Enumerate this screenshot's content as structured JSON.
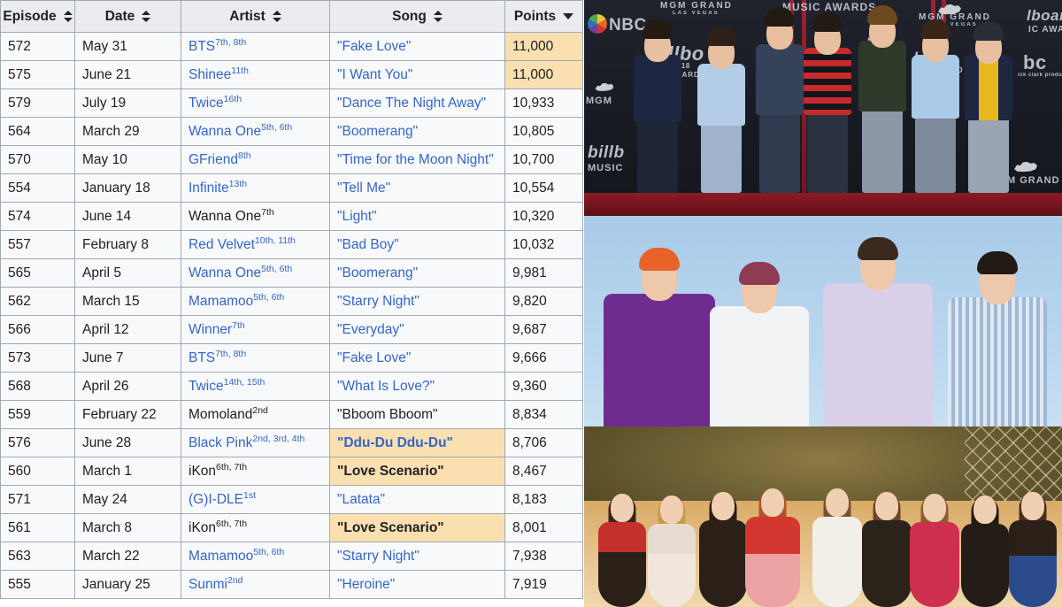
{
  "table": {
    "columns": [
      {
        "label": "Episode",
        "sort": "both"
      },
      {
        "label": "Date",
        "sort": "both"
      },
      {
        "label": "Artist",
        "sort": "both"
      },
      {
        "label": "Song",
        "sort": "both"
      },
      {
        "label": "Points",
        "sort": "desc"
      }
    ],
    "rows": [
      {
        "episode": "572",
        "date": "May 31",
        "artist": "BTS",
        "artist_refs": "7th, 8th",
        "artist_link": true,
        "song": "\"Fake Love\"",
        "song_link": true,
        "points": "11,000",
        "points_highlight": true,
        "song_highlight": false
      },
      {
        "episode": "575",
        "date": "June 21",
        "artist": "Shinee",
        "artist_refs": "11th",
        "artist_link": true,
        "song": "\"I Want You\"",
        "song_link": true,
        "points": "11,000",
        "points_highlight": true,
        "song_highlight": false
      },
      {
        "episode": "579",
        "date": "July 19",
        "artist": "Twice",
        "artist_refs": "16th",
        "artist_link": true,
        "song": "\"Dance The Night Away\"",
        "song_link": true,
        "points": "10,933",
        "points_highlight": false,
        "song_highlight": false
      },
      {
        "episode": "564",
        "date": "March 29",
        "artist": "Wanna One",
        "artist_refs": "5th, 6th",
        "artist_link": true,
        "song": "\"Boomerang\"",
        "song_link": true,
        "points": "10,805",
        "points_highlight": false,
        "song_highlight": false
      },
      {
        "episode": "570",
        "date": "May 10",
        "artist": "GFriend",
        "artist_refs": "8th",
        "artist_link": true,
        "song": "\"Time for the Moon Night\"",
        "song_link": true,
        "points": "10,700",
        "points_highlight": false,
        "song_highlight": false
      },
      {
        "episode": "554",
        "date": "January 18",
        "artist": "Infinite",
        "artist_refs": "13th",
        "artist_link": true,
        "song": "\"Tell Me\"",
        "song_link": true,
        "points": "10,554",
        "points_highlight": false,
        "song_highlight": false
      },
      {
        "episode": "574",
        "date": "June 14",
        "artist": "Wanna One",
        "artist_refs": "7th",
        "artist_link": false,
        "song": "\"Light\"",
        "song_link": true,
        "points": "10,320",
        "points_highlight": false,
        "song_highlight": false
      },
      {
        "episode": "557",
        "date": "February 8",
        "artist": "Red Velvet",
        "artist_refs": "10th, 11th",
        "artist_link": true,
        "song": "\"Bad Boy\"",
        "song_link": true,
        "points": "10,032",
        "points_highlight": false,
        "song_highlight": false
      },
      {
        "episode": "565",
        "date": "April 5",
        "artist": "Wanna One",
        "artist_refs": "5th, 6th",
        "artist_link": true,
        "song": "\"Boomerang\"",
        "song_link": true,
        "points": "9,981",
        "points_highlight": false,
        "song_highlight": false
      },
      {
        "episode": "562",
        "date": "March 15",
        "artist": "Mamamoo",
        "artist_refs": "5th, 6th",
        "artist_link": true,
        "song": "\"Starry Night\"",
        "song_link": true,
        "points": "9,820",
        "points_highlight": false,
        "song_highlight": false
      },
      {
        "episode": "566",
        "date": "April 12",
        "artist": "Winner",
        "artist_refs": "7th",
        "artist_link": true,
        "song": "\"Everyday\"",
        "song_link": true,
        "points": "9,687",
        "points_highlight": false,
        "song_highlight": false
      },
      {
        "episode": "573",
        "date": "June 7",
        "artist": "BTS",
        "artist_refs": "7th, 8th",
        "artist_link": true,
        "song": "\"Fake Love\"",
        "song_link": true,
        "points": "9,666",
        "points_highlight": false,
        "song_highlight": false
      },
      {
        "episode": "568",
        "date": "April 26",
        "artist": "Twice",
        "artist_refs": "14th, 15th",
        "artist_link": true,
        "song": "\"What Is Love?\"",
        "song_link": true,
        "points": "9,360",
        "points_highlight": false,
        "song_highlight": false
      },
      {
        "episode": "559",
        "date": "February 22",
        "artist": "Momoland",
        "artist_refs": "2nd",
        "artist_link": false,
        "song": "\"Bboom Bboom\"",
        "song_link": false,
        "points": "8,834",
        "points_highlight": false,
        "song_highlight": false
      },
      {
        "episode": "576",
        "date": "June 28",
        "artist": "Black Pink",
        "artist_refs": "2nd, 3rd, 4th",
        "artist_link": true,
        "song": "\"Ddu-Du Ddu-Du\"",
        "song_link": true,
        "points": "8,706",
        "points_highlight": false,
        "song_highlight": true
      },
      {
        "episode": "560",
        "date": "March 1",
        "artist": "iKon",
        "artist_refs": "6th, 7th",
        "artist_link": false,
        "song": "\"Love Scenario\"",
        "song_link": false,
        "points": "8,467",
        "points_highlight": false,
        "song_highlight": true
      },
      {
        "episode": "571",
        "date": "May 24",
        "artist": "(G)I-DLE",
        "artist_refs": "1st",
        "artist_link": true,
        "song": "\"Latata\"",
        "song_link": true,
        "points": "8,183",
        "points_highlight": false,
        "song_highlight": false
      },
      {
        "episode": "561",
        "date": "March 8",
        "artist": "iKon",
        "artist_refs": "6th, 7th",
        "artist_link": false,
        "song": "\"Love Scenario\"",
        "song_link": false,
        "points": "8,001",
        "points_highlight": false,
        "song_highlight": true
      },
      {
        "episode": "563",
        "date": "March 22",
        "artist": "Mamamoo",
        "artist_refs": "5th, 6th",
        "artist_link": true,
        "song": "\"Starry Night\"",
        "song_link": true,
        "points": "7,938",
        "points_highlight": false,
        "song_highlight": false
      },
      {
        "episode": "555",
        "date": "January 25",
        "artist": "Sunmi",
        "artist_refs": "2nd",
        "artist_link": true,
        "song": "\"Heroine\"",
        "song_link": true,
        "points": "7,919",
        "points_highlight": false,
        "song_highlight": false
      }
    ]
  },
  "photos": [
    {
      "name": "bts-billboard-music-awards-photo",
      "members": 7,
      "watermarks": [
        "NBC",
        "MGM GRAND",
        "LAS VEGAS",
        "MUSIC AWARDS",
        "billboard",
        "MUSIC AWARDS",
        "dick clark productions"
      ]
    },
    {
      "name": "shinee-group-photo",
      "members": 4,
      "watermarks": []
    },
    {
      "name": "twice-group-photo",
      "members": 9,
      "watermarks": []
    }
  ],
  "colors": {
    "link": "#3366cc",
    "text": "#202122",
    "highlight": "#fadfb0",
    "header_bg": "#eaecf0",
    "cell_bg": "#f8f9fa",
    "border": "#a2a9b1"
  }
}
